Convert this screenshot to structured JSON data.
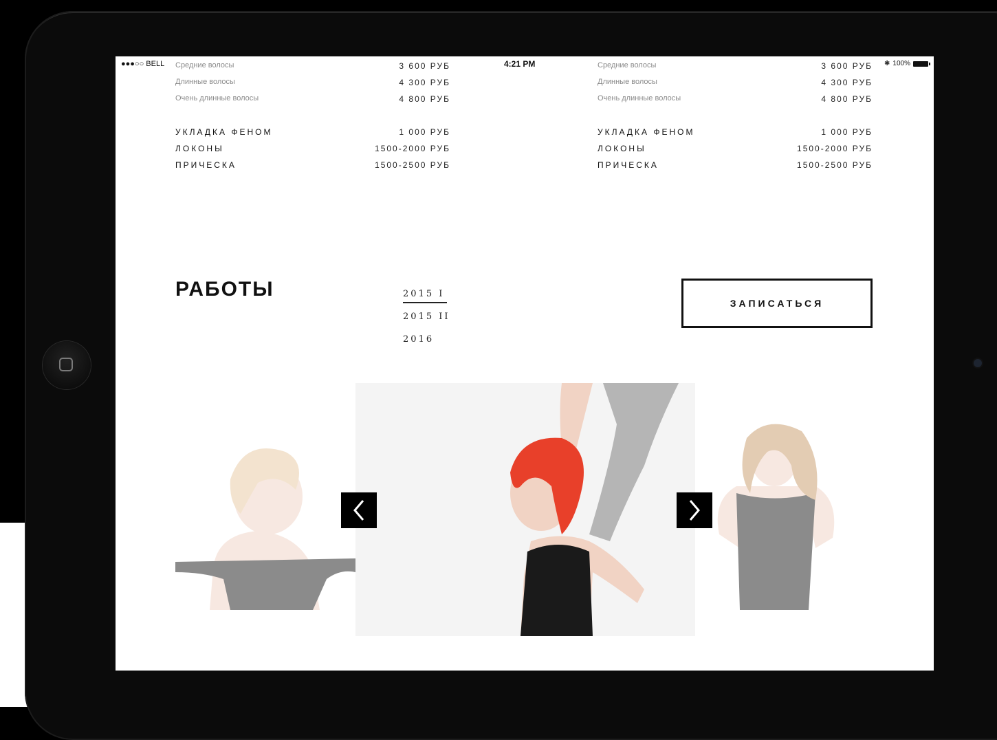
{
  "status_bar": {
    "carrier": "●●●○○ BELL",
    "time": "4:21 PM",
    "battery": "100%"
  },
  "pricing": {
    "left": [
      {
        "name": "Средние волосы",
        "price": "3 600 РУБ",
        "style": "small"
      },
      {
        "name": "Длинные волосы",
        "price": "4 300 РУБ",
        "style": "small"
      },
      {
        "name": "Очень длинные волосы",
        "price": "4 800 РУБ",
        "style": "small"
      },
      {
        "name": "УКЛАДКА ФЕНОМ",
        "price": "1 000 РУБ",
        "style": "caps"
      },
      {
        "name": "ЛОКОНЫ",
        "price": "1500-2000 РУБ",
        "style": "caps"
      },
      {
        "name": "ПРИЧЕСКА",
        "price": "1500-2500 РУБ",
        "style": "caps"
      }
    ],
    "right": [
      {
        "name": "Средние волосы",
        "price": "3 600 РУБ",
        "style": "small"
      },
      {
        "name": "Длинные волосы",
        "price": "4 300 РУБ",
        "style": "small"
      },
      {
        "name": "Очень длинные волосы",
        "price": "4 800 РУБ",
        "style": "small"
      },
      {
        "name": "УКЛАДКА ФЕНОМ",
        "price": "1 000 РУБ",
        "style": "caps"
      },
      {
        "name": "ЛОКОНЫ",
        "price": "1500-2000 РУБ",
        "style": "caps"
      },
      {
        "name": "ПРИЧЕСКА",
        "price": "1500-2500 РУБ",
        "style": "caps"
      }
    ]
  },
  "works": {
    "title": "РАБОТЫ",
    "years": [
      {
        "label": "2015 I",
        "active": true
      },
      {
        "label": "2015 II",
        "active": false
      },
      {
        "label": "2016",
        "active": false
      }
    ],
    "book_label": "ЗАПИСАТЬСЯ"
  },
  "gallery": {
    "prev_icon": "chevron-left-icon",
    "next_icon": "chevron-right-icon",
    "colors": {
      "left_hair": "#e8c9a0",
      "center_hair": "#e8402a",
      "right_hair": "#c89a6a",
      "skin": "#f1d3c4",
      "dress": "#1a1a1a"
    }
  }
}
